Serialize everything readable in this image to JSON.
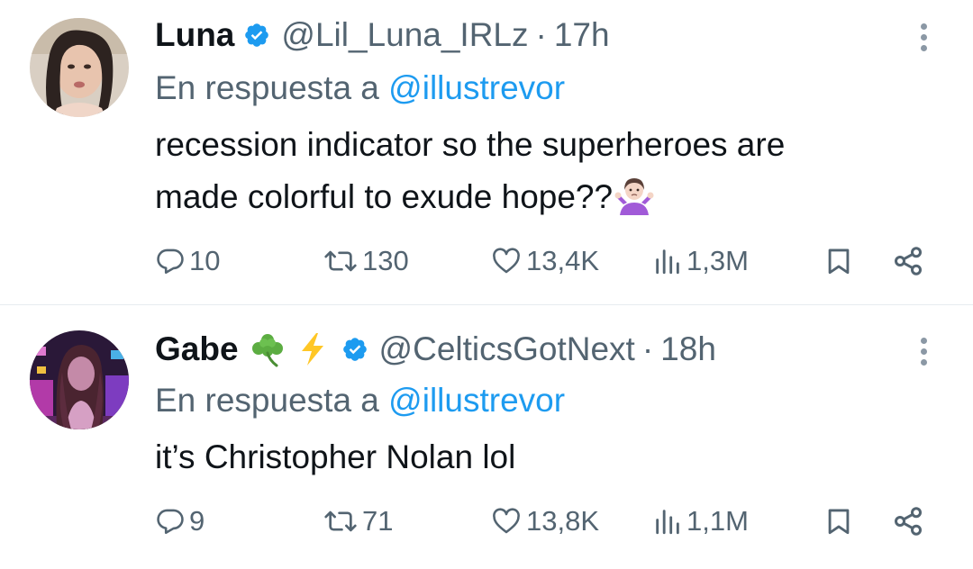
{
  "tweets": [
    {
      "display_name": "Luna",
      "name_emoji": [],
      "handle": "@Lil_Luna_IRLz",
      "separator": "·",
      "time": "17h",
      "reply_prefix": "En respuesta a",
      "reply_mention": "@illustrevor",
      "text_line1": "recession indicator so the superheroes are",
      "text_line2": "made colorful to exude hope??",
      "text_emoji": "person-shrugging",
      "replies": "10",
      "retweets": "130",
      "likes": "13,4K",
      "views": "1,3M"
    },
    {
      "display_name": "Gabe",
      "name_emoji": [
        "shamrock",
        "high-voltage"
      ],
      "handle": "@CelticsGotNext",
      "separator": "·",
      "time": "18h",
      "reply_prefix": "En respuesta a",
      "reply_mention": "@illustrevor",
      "text_line1": "it’s Christopher Nolan lol",
      "replies": "9",
      "retweets": "71",
      "likes": "13,8K",
      "views": "1,1M"
    }
  ],
  "colors": {
    "text": "#0f1419",
    "secondary": "#536471",
    "link": "#1d9bf0",
    "verified": "#1d9bf0",
    "divider": "#e6ecf0"
  }
}
